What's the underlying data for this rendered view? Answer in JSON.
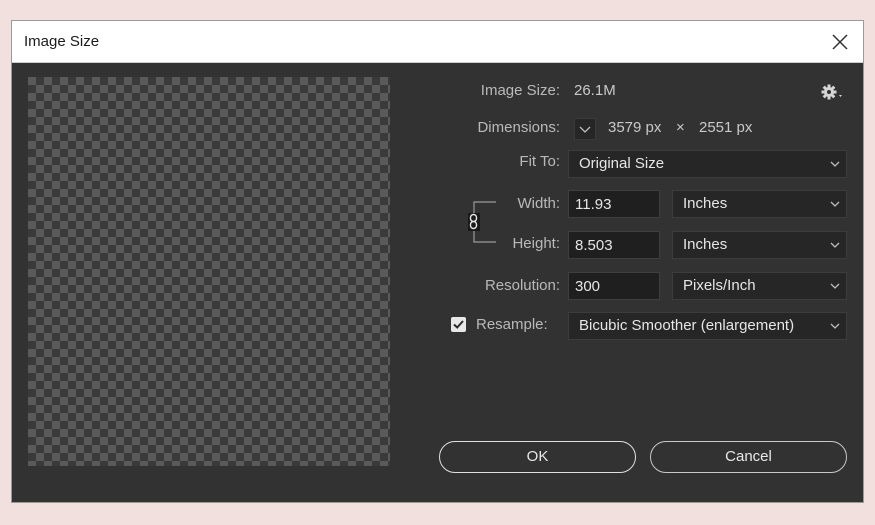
{
  "dialog": {
    "title": "Image Size",
    "close_icon": "close-icon"
  },
  "info": {
    "image_size_label": "Image Size:",
    "image_size_value": "26.1M",
    "dimensions_label": "Dimensions:",
    "dim_width": "3579 px",
    "dim_times": "×",
    "dim_height": "2551 px"
  },
  "fit_to": {
    "label": "Fit To:",
    "value": "Original Size"
  },
  "width": {
    "label": "Width:",
    "value": "11.93",
    "unit": "Inches"
  },
  "height": {
    "label": "Height:",
    "value": "8.503",
    "unit": "Inches"
  },
  "resolution": {
    "label": "Resolution:",
    "value": "300",
    "unit": "Pixels/Inch"
  },
  "resample": {
    "label": "Resample:",
    "checked": true,
    "value": "Bicubic Smoother (enlargement)"
  },
  "buttons": {
    "ok": "OK",
    "cancel": "Cancel"
  },
  "colors": {
    "dialog_bg": "#323232",
    "page_bg": "#f1e0dd",
    "field_bg": "#1f1f1f"
  }
}
